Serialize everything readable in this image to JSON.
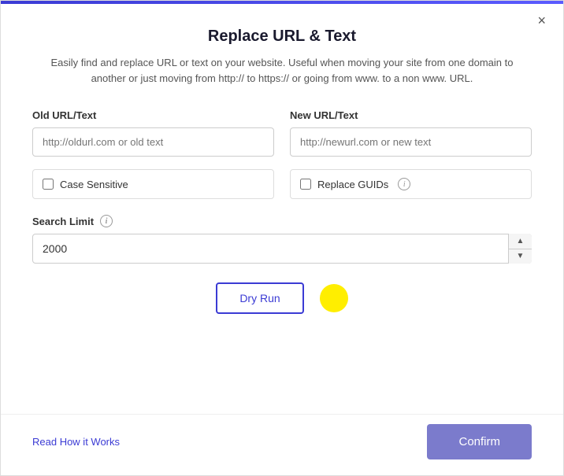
{
  "dialog": {
    "title": "Replace URL & Text",
    "description": "Easily find and replace URL or text on your website. Useful when moving your site from one domain to another or just moving from http:// to https:// or going from www. to a non www. URL.",
    "close_label": "×",
    "old_url_label": "Old URL/Text",
    "old_url_placeholder": "http://oldurl.com or old text",
    "new_url_label": "New URL/Text",
    "new_url_placeholder": "http://newurl.com or new text",
    "case_sensitive_label": "Case Sensitive",
    "replace_guids_label": "Replace GUIDs",
    "search_limit_label": "Search Limit",
    "search_limit_value": "2000",
    "dry_run_label": "Dry Run",
    "read_how_label": "Read How it Works",
    "confirm_label": "Confirm",
    "info_icon": "i"
  }
}
